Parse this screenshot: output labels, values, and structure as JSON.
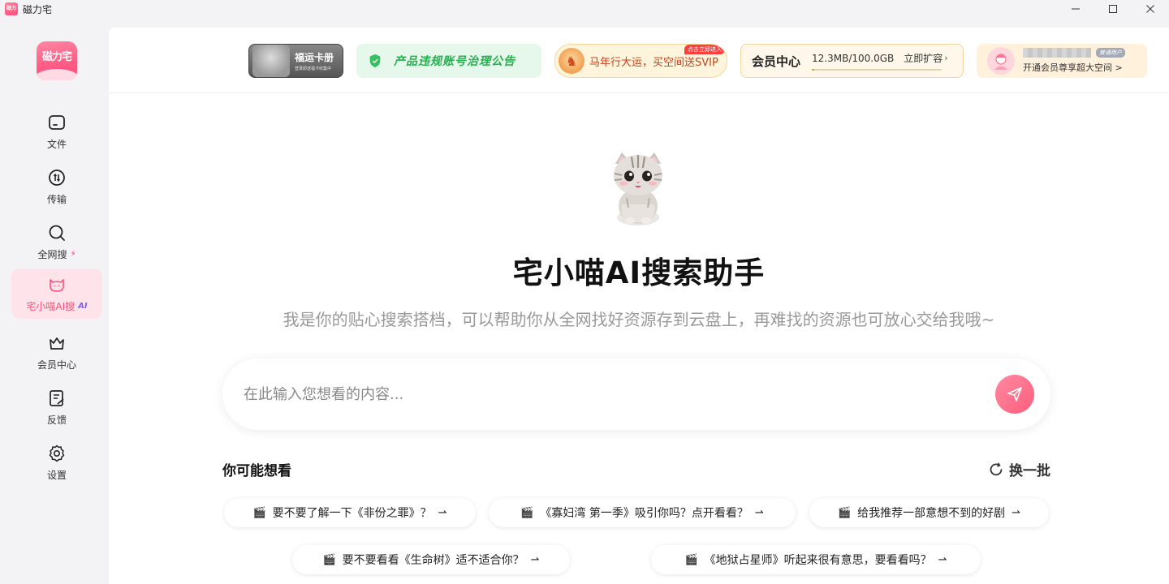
{
  "window": {
    "title": "磁力宅",
    "mini_logo": "磁力宅"
  },
  "sidebar": {
    "logo_text": "磁力宅",
    "items": [
      {
        "label": "文件",
        "icon": "folder-icon"
      },
      {
        "label": "传输",
        "icon": "transfer-icon"
      },
      {
        "label": "全网搜",
        "icon": "search-icon"
      },
      {
        "label": "宅小喵AI搜",
        "icon": "cat-icon",
        "badge": "AI",
        "active": true
      },
      {
        "label": "会员中心",
        "icon": "crown-icon"
      },
      {
        "label": "反馈",
        "icon": "feedback-icon"
      },
      {
        "label": "设置",
        "icon": "gear-icon"
      }
    ]
  },
  "topbar": {
    "fuyun": {
      "title": "福运卡册",
      "subtitle": "登录即送福卡收集中"
    },
    "notice": {
      "text": "产品违规账号治理公告"
    },
    "svip": {
      "text": "马年行大运，买空间送SVIP",
      "tag": "点击立即进入"
    },
    "member": {
      "title": "会员中心",
      "usage": "12.3MB/100.0GB",
      "expand": "立即扩容",
      "usage_fraction": 0.00012
    },
    "user": {
      "badge": "普通用户",
      "hint": "开通会员尊享超大空间"
    }
  },
  "hero": {
    "title": "宅小喵AI搜索助手",
    "subtitle": "我是你的贴心搜索搭档，可以帮助你从全网找好资源存到云盘上，再难找的资源也可放心交给我哦~"
  },
  "search": {
    "placeholder": "在此输入您想看的内容...",
    "value": ""
  },
  "suggestions": {
    "title": "你可能想看",
    "refresh_label": "换一批",
    "items": [
      "要不要了解一下《非份之罪》？",
      "《寡妇湾 第一季》吸引你吗？点开看看？",
      "给我推荐一部意想不到的好剧",
      "要不要看看《生命树》适不适合你？",
      "《地狱占星师》听起来很有意思，要看看吗？"
    ]
  },
  "colors": {
    "accent": "#ff4f7a",
    "active_bg": "#ffe3ea",
    "notice_green": "#27b04f"
  }
}
